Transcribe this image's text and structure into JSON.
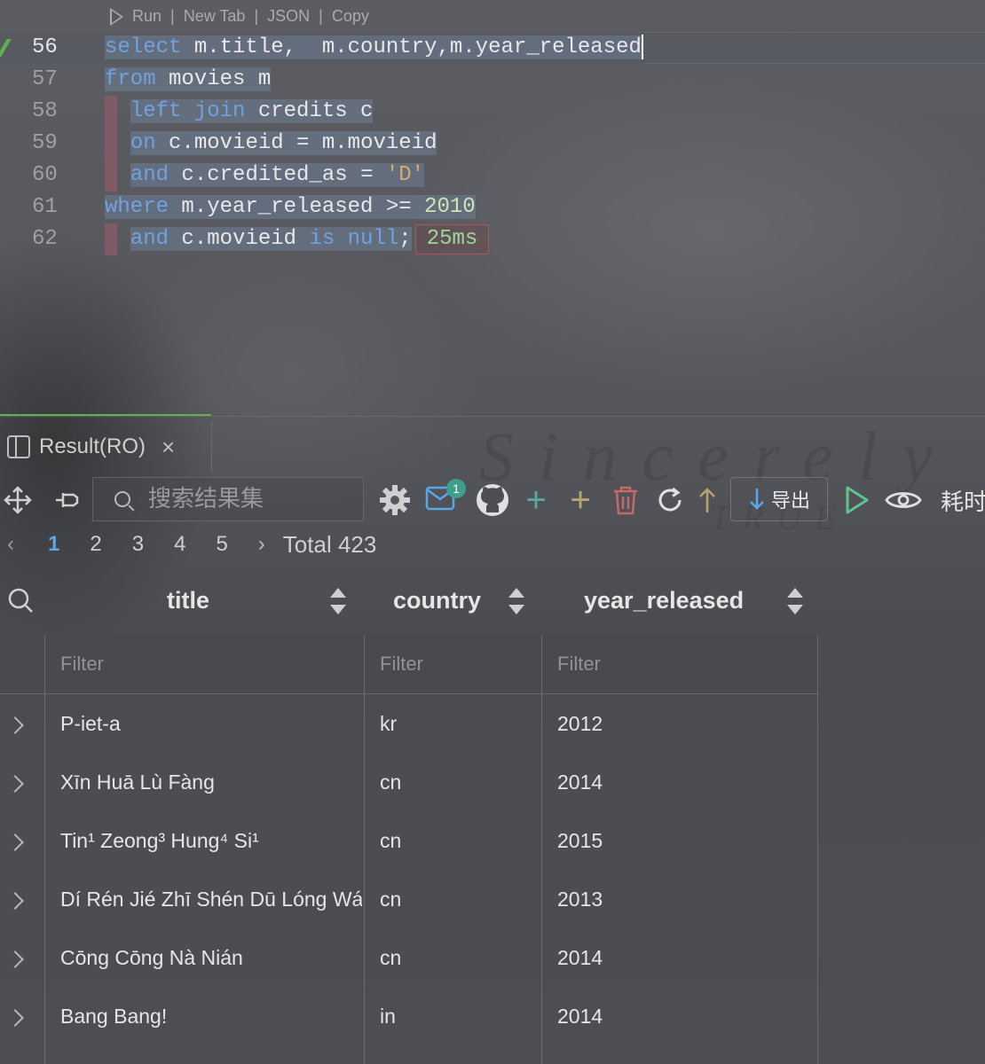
{
  "codelens": {
    "run": "Run",
    "new_tab": "New Tab",
    "json": "JSON",
    "copy": "Copy",
    "sep": "|"
  },
  "editor": {
    "lines": [
      {
        "num": "56",
        "parts": [
          "select",
          " m.title,  m.country,m.year_released"
        ]
      },
      {
        "num": "57",
        "parts": [
          "from",
          " movies m"
        ]
      },
      {
        "num": "58",
        "parts": [
          "left join",
          " credits c"
        ]
      },
      {
        "num": "59",
        "parts": [
          "on",
          " c.movieid = m.movieid"
        ]
      },
      {
        "num": "60",
        "parts": [
          "and",
          " c.credited_as = ",
          "'D'"
        ]
      },
      {
        "num": "61",
        "parts": [
          "where",
          " m.year_released >= ",
          "2010"
        ]
      },
      {
        "num": "62",
        "parts": [
          "and",
          " c.movieid ",
          "is null",
          ";"
        ]
      }
    ],
    "timing": "25ms"
  },
  "result_tab": {
    "label": "Result(RO)",
    "close": "×"
  },
  "toolbar": {
    "search_placeholder": "搜索结果集",
    "mail_badge": "1",
    "export_label": "导出",
    "cost_label": "耗时"
  },
  "pager": {
    "pages": [
      "1",
      "2",
      "3",
      "4",
      "5"
    ],
    "current": "1",
    "total": "Total 423"
  },
  "table": {
    "columns": [
      "title",
      "country",
      "year_released"
    ],
    "filter_placeholder": "Filter",
    "rows": [
      [
        "P-iet-a",
        "kr",
        "2012"
      ],
      [
        "Xīn Huā Lù Fàng",
        "cn",
        "2014"
      ],
      [
        "Tin¹ Zeong³ Hung⁴ Si¹",
        "cn",
        "2015"
      ],
      [
        "Dí Rén Jié Zhī Shén Dū Lóng Wáng",
        "cn",
        "2013"
      ],
      [
        "Cōng Cōng Nà Nián",
        "cn",
        "2014"
      ],
      [
        "Bang Bang!",
        "in",
        "2014"
      ]
    ]
  }
}
